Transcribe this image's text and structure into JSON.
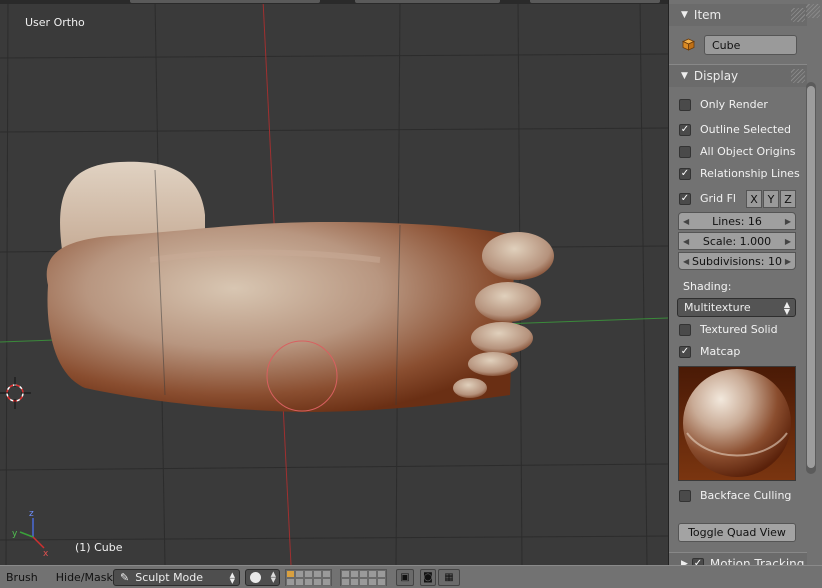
{
  "viewport": {
    "view_label": "User Ortho",
    "object_label": "(1) Cube"
  },
  "panel": {
    "item_section": {
      "title": "Item",
      "object_name": "Cube"
    },
    "display_section": {
      "title": "Display",
      "only_render": {
        "label": "Only Render",
        "checked": false
      },
      "outline_selected": {
        "label": "Outline Selected",
        "checked": true
      },
      "all_object_origins": {
        "label": "All Object Origins",
        "checked": false
      },
      "relationship_lines": {
        "label": "Relationship Lines",
        "checked": true
      },
      "grid_floor": {
        "label": "Grid Fl",
        "checked": true
      },
      "axis_x": "X",
      "axis_y": "Y",
      "axis_z": "Z",
      "lines": "Lines: 16",
      "scale": "Scale: 1.000",
      "subdivisions": "Subdivisions: 10"
    },
    "shading": {
      "label": "Shading:",
      "mode": "Multitexture",
      "textured_solid": {
        "label": "Textured Solid",
        "checked": false
      },
      "matcap": {
        "label": "Matcap",
        "checked": true
      },
      "backface_culling": {
        "label": "Backface Culling",
        "checked": false
      },
      "toggle_quad_view": "Toggle Quad View"
    },
    "motion_tracking": {
      "title": "Motion Tracking",
      "checked": true
    }
  },
  "statusbar": {
    "brush": "Brush",
    "hide_mask": "Hide/Mask",
    "mode": "Sculpt Mode"
  },
  "colors": {
    "matcap_dark": "#6a2a10",
    "skin_light": "#d9c8b4",
    "grid_line": "#2e2e2e",
    "axis_red": "#a03030",
    "axis_green": "#3a8a3a"
  }
}
